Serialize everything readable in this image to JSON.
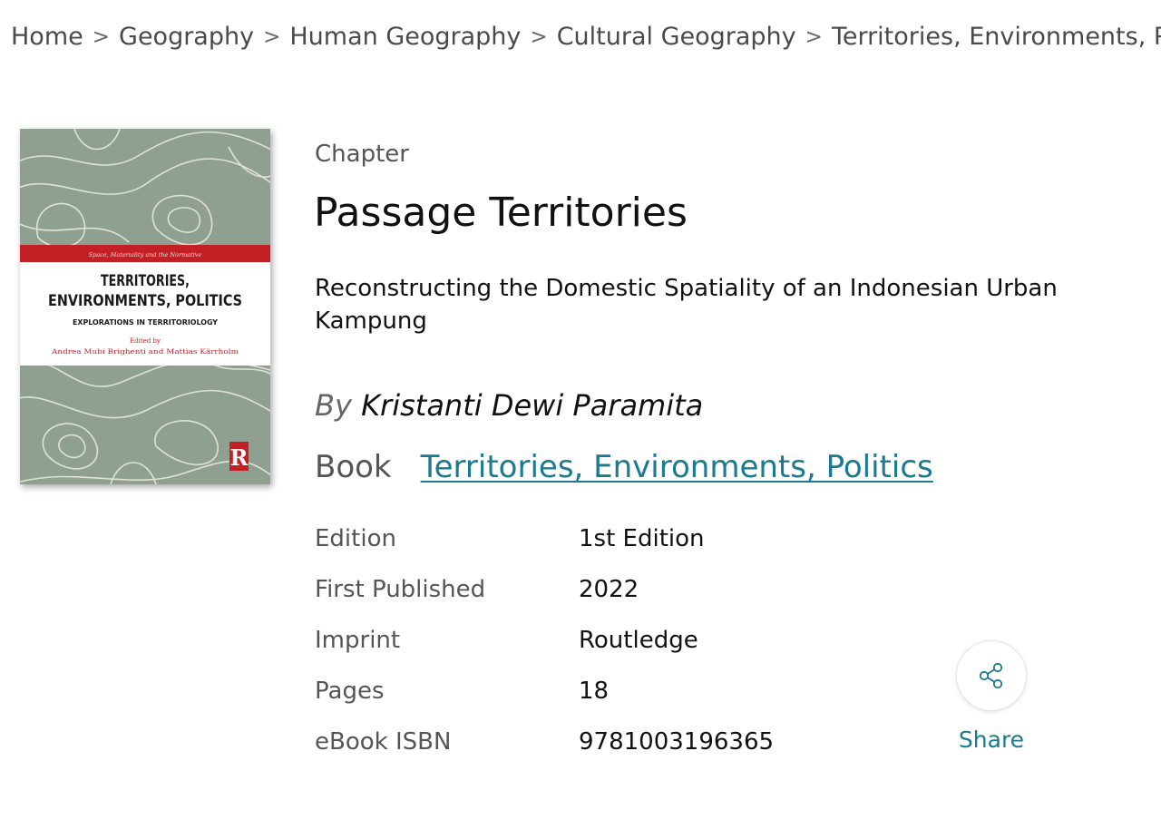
{
  "breadcrumb": {
    "items": [
      "Home",
      "Geography",
      "Human Geography",
      "Cultural Geography",
      "Territories, Environments, Poli"
    ]
  },
  "cover": {
    "series": "Space, Materiality and the Normative",
    "title_line1": "TERRITORIES,",
    "title_line2": "ENVIRONMENTS, POLITICS",
    "subtitle": "EXPLORATIONS IN TERRITORIOLOGY",
    "edited_by": "Edited by",
    "editors": "Andrea Mubi Brighenti and Mattias Kärrholm",
    "publisher_logo": "R",
    "colors": {
      "background": "#8fa090",
      "band": "#c32026",
      "pattern": "#e9eadb"
    }
  },
  "content_type": "Chapter",
  "title": "Passage Territories",
  "subtitle": "Reconstructing the Domestic Spatiality of an Indonesian Urban Kampung",
  "byline": {
    "prefix": "By",
    "author": "Kristanti Dewi Paramita"
  },
  "book": {
    "label": "Book",
    "link": "Territories, Environments, Politics"
  },
  "details": [
    {
      "key": "Edition",
      "value": "1st Edition"
    },
    {
      "key": "First Published",
      "value": "2022"
    },
    {
      "key": "Imprint",
      "value": "Routledge"
    },
    {
      "key": "Pages",
      "value": "18"
    },
    {
      "key": "eBook ISBN",
      "value": "9781003196365"
    }
  ],
  "share": {
    "label": "Share",
    "icon": "share-icon"
  },
  "theme": {
    "link_color": "#1a7a8f"
  }
}
